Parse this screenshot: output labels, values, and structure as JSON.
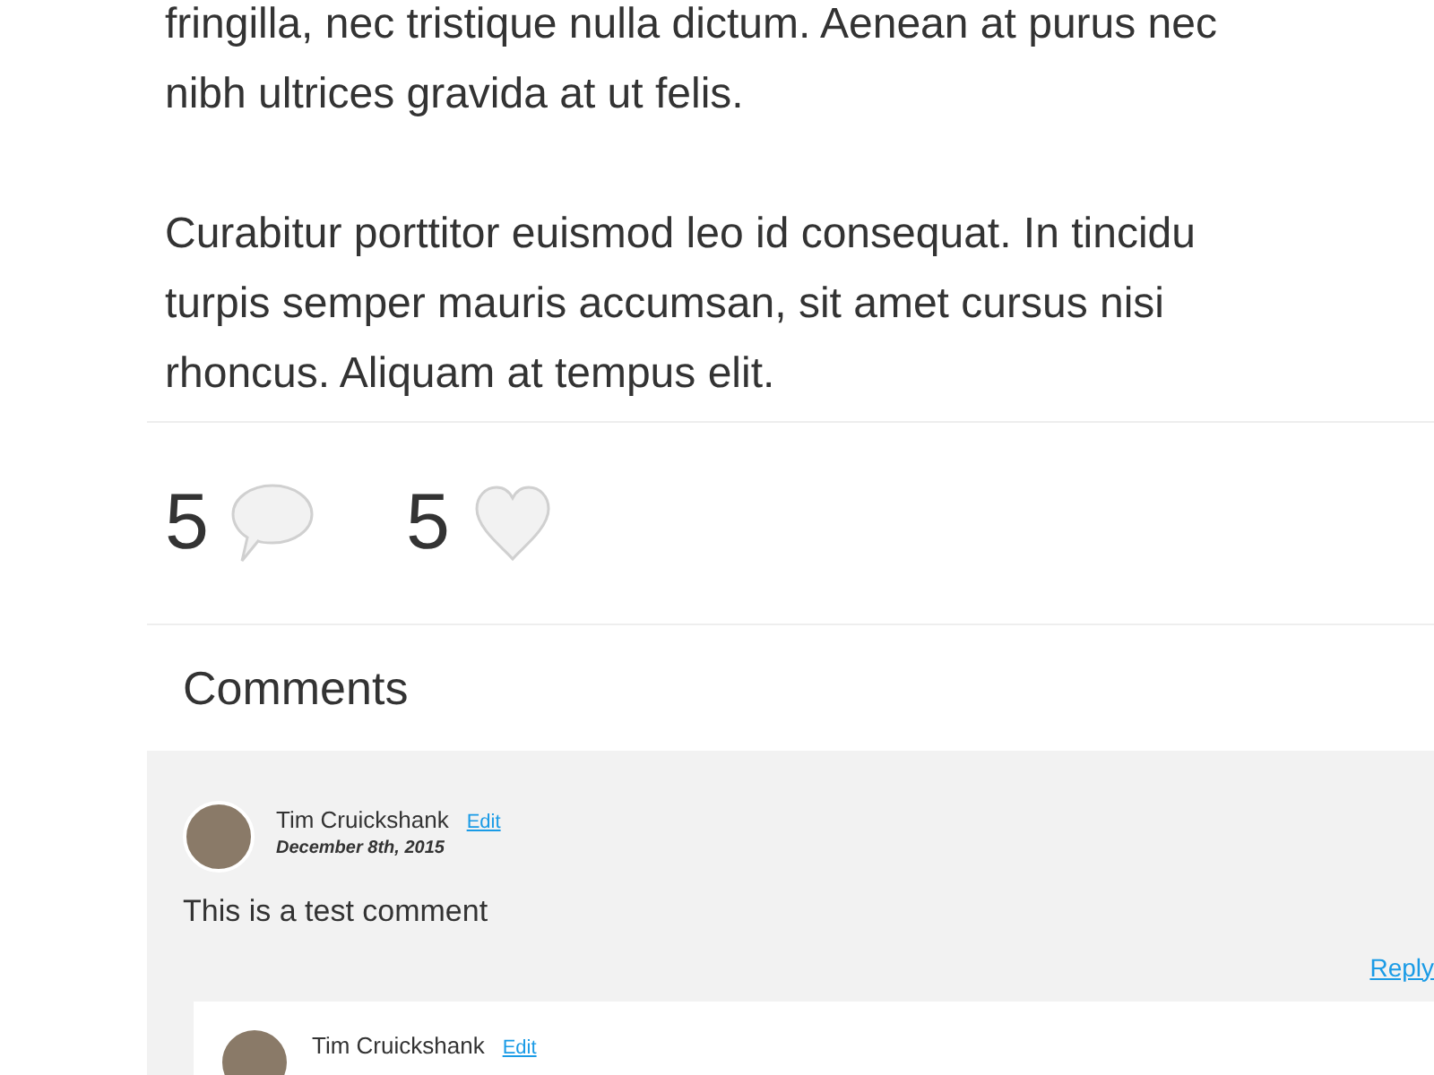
{
  "article": {
    "paragraphs": [
      [
        "fringilla, nec tristique nulla dictum. Aenean at purus nec",
        "nibh ultrices gravida at ut felis."
      ],
      [
        "Curabitur porttitor euismod leo id consequat. In tincidu",
        "turpis semper mauris accumsan, sit amet cursus nisi",
        "rhoncus. Aliquam at tempus elit."
      ]
    ]
  },
  "stats": [
    {
      "kind": "comments",
      "count": "5"
    },
    {
      "kind": "likes",
      "count": "5"
    }
  ],
  "comments_heading": "Comments",
  "comments": [
    {
      "author": "Tim Cruickshank",
      "edit": "Edit",
      "date": "December 8th, 2015",
      "text": "This is a test comment",
      "reply": "Reply",
      "children": [
        {
          "author": "Tim Cruickshank",
          "edit": "Edit"
        }
      ]
    }
  ]
}
